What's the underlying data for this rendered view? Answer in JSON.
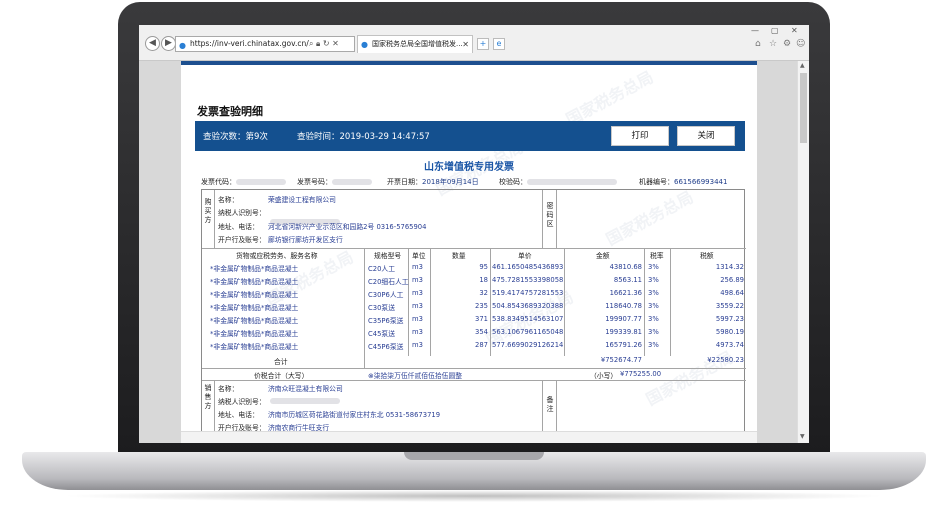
{
  "browser": {
    "url": "https://inv-veri.chinatax.gov.cn/",
    "tab_title": "国家税务总局全国增值税发..."
  },
  "dialog": {
    "title": "发票查验明细",
    "check_count": "查验次数：第9次",
    "check_time": "查验时间：2019-03-29 14:47:57",
    "print_label": "打印",
    "close_label": "关闭",
    "watermark": "国家税务总局"
  },
  "invoice": {
    "title": "山东增值税专用发票",
    "code_label": "发票代码：",
    "number_label": "发票号码：",
    "date_label": "开票日期：",
    "date_value": "2018年09月14日",
    "check_code_label": "校验码：",
    "machine_label": "机器编号：",
    "machine_value": "661566993441",
    "buyer": {
      "side": "购买方",
      "name_label": "名称：",
      "name": "荣盛建设工程有限公司",
      "tax_id_label": "纳税人识别号：",
      "address_label": "地址、电话：",
      "address": "河北省河新兴产业示范区和园路2号 0316-5765904",
      "bank_label": "开户行及账号：",
      "bank": "廊坊银行廊坊开发区支行"
    },
    "secret_label": "密码区",
    "columns": [
      "货物或应税劳务、服务名称",
      "规格型号",
      "单位",
      "数量",
      "单价",
      "金额",
      "税率",
      "税额"
    ],
    "items": [
      {
        "name": "*非金属矿物制品*商品混凝土",
        "spec": "C20人工",
        "unit": "m3",
        "qty": "95",
        "price": "461.1650485436893",
        "amount": "43810.68",
        "rate": "3%",
        "tax": "1314.32"
      },
      {
        "name": "*非金属矿物制品*商品混凝土",
        "spec": "C20细石人工",
        "unit": "m3",
        "qty": "18",
        "price": "475.7281553398058",
        "amount": "8563.11",
        "rate": "3%",
        "tax": "256.89"
      },
      {
        "name": "*非金属矿物制品*商品混凝土",
        "spec": "C30P6人工",
        "unit": "m3",
        "qty": "32",
        "price": "519.4174757281553",
        "amount": "16621.36",
        "rate": "3%",
        "tax": "498.64"
      },
      {
        "name": "*非金属矿物制品*商品混凝土",
        "spec": "C30泵送",
        "unit": "m3",
        "qty": "235",
        "price": "504.8543689320388",
        "amount": "118640.78",
        "rate": "3%",
        "tax": "3559.22"
      },
      {
        "name": "*非金属矿物制品*商品混凝土",
        "spec": "C35P6泵送",
        "unit": "m3",
        "qty": "371",
        "price": "538.8349514563107",
        "amount": "199907.77",
        "rate": "3%",
        "tax": "5997.23"
      },
      {
        "name": "*非金属矿物制品*商品混凝土",
        "spec": "C45泵送",
        "unit": "m3",
        "qty": "354",
        "price": "563.1067961165048",
        "amount": "199339.81",
        "rate": "3%",
        "tax": "5980.19"
      },
      {
        "name": "*非金属矿物制品*商品混凝土",
        "spec": "C45P6泵送",
        "unit": "m3",
        "qty": "287",
        "price": "577.6699029126214",
        "amount": "165791.26",
        "rate": "3%",
        "tax": "4973.74"
      }
    ],
    "subtotal_label": "合计",
    "subtotal_amount": "¥752674.77",
    "subtotal_tax": "¥22580.23",
    "total_label": "价税合计（大写）",
    "total_words": "⊗柒拾柒万伍仟贰佰伍拾伍圆整",
    "total_small_label": "（小写）",
    "total_small": "¥775255.00",
    "seller": {
      "side": "销售方",
      "name_label": "名称：",
      "name": "济南众旺混凝土有限公司",
      "tax_id_label": "纳税人识别号：",
      "address_label": "地址、电话：",
      "address": "济南市历城区荷花路街道付家庄村东北 0531-58673719",
      "bank_label": "开户行及账号：",
      "bank": "济南农商行牛旺支行"
    },
    "remark_label": "备注"
  }
}
